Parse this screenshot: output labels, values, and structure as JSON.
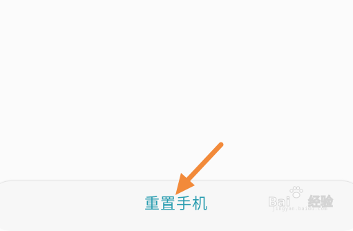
{
  "reset_button": {
    "label": "重置手机"
  },
  "colors": {
    "accent": "#2a9db0",
    "arrow": "#f28a3a",
    "background": "#fbfbfb"
  },
  "watermark": {
    "text": "Bai",
    "text2": "经验",
    "sub": "jingyan.baidu.com"
  }
}
